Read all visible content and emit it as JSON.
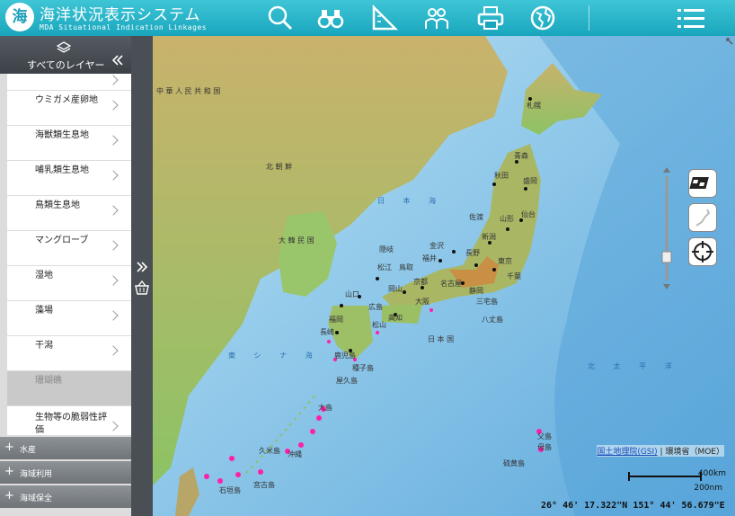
{
  "header": {
    "logo_char": "海",
    "title": "海洋状況表示システム",
    "subtitle": "MDA Situational Indication Linkages",
    "toolbar": [
      "search-icon",
      "binoculars-icon",
      "ruler-icon",
      "users-icon",
      "print-icon",
      "globe-icon",
      "menu-icon"
    ]
  },
  "panel": {
    "header_label": "すべてのレイヤー",
    "items": [
      {
        "label": ""
      },
      {
        "label": "ウミガメ産卵地"
      },
      {
        "label": "海獣類生息地"
      },
      {
        "label": "哺乳類生息地"
      },
      {
        "label": "鳥類生息地"
      },
      {
        "label": "マングローブ"
      },
      {
        "label": "湿地"
      },
      {
        "label": "藻場"
      },
      {
        "label": "干潟"
      },
      {
        "label": "珊瑚礁"
      },
      {
        "label": "生物等の脆弱性評価"
      }
    ],
    "categories": [
      {
        "label": "水産"
      },
      {
        "label": "海域利用"
      },
      {
        "label": "海域保全"
      }
    ]
  },
  "map": {
    "labels": {
      "china": "中 華 人 民 共 和 国",
      "nk": "北 朝 鮮",
      "korea": "大 韓 民 国",
      "japan": "日 本 国",
      "sea_japan": "日 本 海",
      "east_china_sea": "東 シ ナ 海",
      "pacific": "北 太 平 洋",
      "sapporo": "札幌",
      "aomori": "青森",
      "akita": "秋田",
      "morioka": "盛岡",
      "sendai": "仙台",
      "yamagata": "山形",
      "niigata": "新潟",
      "kanazawa": "金沢",
      "fukui": "福井",
      "nagano": "長野",
      "tokyo": "東京",
      "chiba": "千葉",
      "shizuoka": "静岡",
      "nagoya": "名古屋",
      "kyoto": "京都",
      "osaka": "大阪",
      "matsue": "松江",
      "tottori": "鳥取",
      "okayama": "岡山",
      "hiroshima": "広島",
      "yamaguchi": "山口",
      "fukuoka": "福岡",
      "nagasaki": "長崎",
      "kagoshima": "鹿児島",
      "kochi": "高知",
      "matsuyama": "松山",
      "oki": "隠岐",
      "sado": "佐渡",
      "hachijo": "八丈島",
      "miyake": "三宅島",
      "tanegashima": "種子島",
      "yakushima": "屋久島",
      "amami": "大島",
      "okinawa": "沖縄",
      "kume": "久米島",
      "miyako": "宮古島",
      "ishigaki": "石垣島",
      "iwo": "硫黄島",
      "chichijima": "父島",
      "hahajima": "母島"
    },
    "credit_gsi": "国土地理院(GSI)",
    "credit_sep": " | ",
    "credit_moe": "環境省（MOE）",
    "scale_km": "400km",
    "scale_nm": "200nm",
    "coordinates": "26° 46' 17.322\"N 151° 44' 56.679\"E",
    "colors": {
      "sea_deep": "#5fb0de",
      "sea_shallow": "#a8d9f0",
      "land_low": "#7fbf5a",
      "land_high": "#d89c4a",
      "habitat": "#ff1fa8",
      "accent": "#1aa7bd"
    }
  }
}
